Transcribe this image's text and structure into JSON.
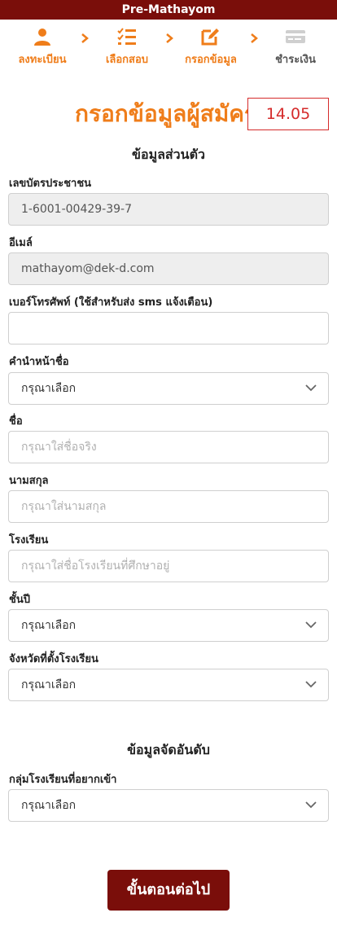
{
  "app_title": "Pre-Mathayom",
  "steps": [
    {
      "label": "ลงทะเบียน",
      "icon": "user-icon",
      "state": "active"
    },
    {
      "label": "เลือกสอบ",
      "icon": "checklist-icon",
      "state": "active"
    },
    {
      "label": "กรอกข้อมูล",
      "icon": "edit-icon",
      "state": "active"
    },
    {
      "label": "ชำระเงิน",
      "icon": "payment-card-icon",
      "state": "inactive"
    }
  ],
  "page_title": "กรอกข้อมูลผู้สมัคร",
  "timer": "14.05",
  "personal_section": {
    "title": "ข้อมูลส่วนตัว",
    "id_card": {
      "label": "เลขบัตรประชาชน",
      "value": "1-6001-00429-39-7"
    },
    "email": {
      "label": "อีเมล์",
      "value": "mathayom@dek-d.com"
    },
    "phone": {
      "label": "เบอร์โทรศัพท์ (ใช้สำหรับส่ง sms แจ้งเตือน)",
      "placeholder": ""
    },
    "prefix": {
      "label": "คำนำหน้าชื่อ",
      "selected": "กรุณาเลือก"
    },
    "first_name": {
      "label": "ชื่อ",
      "placeholder": "กรุณาใส่ชื่อจริง"
    },
    "last_name": {
      "label": "นามสกุล",
      "placeholder": "กรุณาใส่นามสกุล"
    },
    "school": {
      "label": "โรงเรียน",
      "placeholder": "กรุณาใส่ชื่อโรงเรียนที่ศึกษาอยู่"
    },
    "grade": {
      "label": "ชั้นปี",
      "selected": "กรุณาเลือก"
    },
    "province": {
      "label": "จังหวัดที่ตั้งโรงเรียน",
      "selected": "กรุณาเลือก"
    }
  },
  "ranking_section": {
    "title": "ข้อมูลจัดอันดับ",
    "school_group": {
      "label": "กลุ่มโรงเรียนที่อยากเข้า",
      "selected": "กรุณาเลือก"
    }
  },
  "next_button": "ขั้นตอนต่อไป",
  "colors": {
    "brand": "#7a0e0a",
    "accent": "#ef7d1a",
    "timer": "#d52b2b"
  }
}
